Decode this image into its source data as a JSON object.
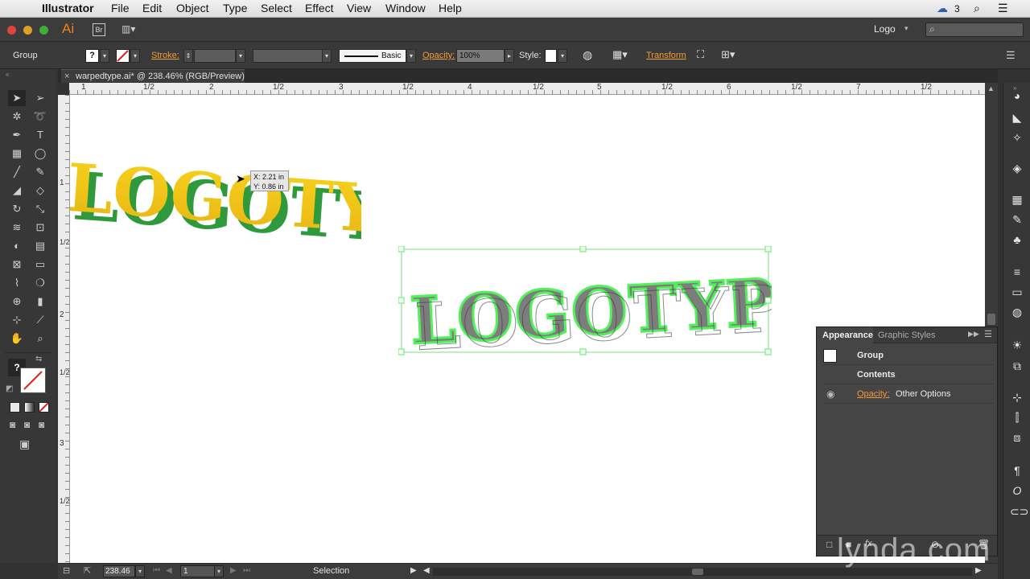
{
  "menubar": {
    "items": [
      "Illustrator",
      "File",
      "Edit",
      "Object",
      "Type",
      "Select",
      "Effect",
      "View",
      "Window",
      "Help"
    ],
    "cc_count": "3"
  },
  "appbar": {
    "app_badge": "Ai",
    "bridge_badge": "Br",
    "workspace": "Logo",
    "search_placeholder": ""
  },
  "control_bar": {
    "selection_type": "Group",
    "fill_badge": "?",
    "stroke_label": "Stroke:",
    "brush_label": "Basic",
    "opacity_label": "Opacity:",
    "opacity_value": "100%",
    "style_label": "Style:",
    "transform_label": "Transform"
  },
  "document": {
    "tab_title": "warpedtype.ai* @ 238.46% (RGB/Preview)",
    "tab_close": "×"
  },
  "ruler_h": [
    "1",
    "1/2",
    "2",
    "1/2",
    "3",
    "1/2",
    "4",
    "1/2",
    "5",
    "1/2",
    "6",
    "1/2",
    "7",
    "1/2"
  ],
  "ruler_v": [
    "1",
    "1/2",
    "2",
    "1/2",
    "3",
    "1/2"
  ],
  "canvas": {
    "logotype_text": "LOGOTYPE",
    "tooltip_x": "X: 2.21 in",
    "tooltip_y": "Y: 0.86 in",
    "colors": {
      "yellow": "#f2c417",
      "green": "#2f9a3c",
      "selection": "#52f05a",
      "shadow": "#3a3a3a",
      "mid": "#7d7d7d"
    }
  },
  "toolbar": {
    "fill_question": "?"
  },
  "statusbar": {
    "zoom": "238.46",
    "artboard": "1",
    "tool_name": "Selection"
  },
  "appearance_panel": {
    "tab_appearance": "Appearance",
    "tab_graphic_styles": "Graphic Styles",
    "row_group": "Group",
    "row_contents": "Contents",
    "opacity_label": "Opacity:",
    "opacity_value": "Other Options"
  },
  "watermark": "lynda.com"
}
